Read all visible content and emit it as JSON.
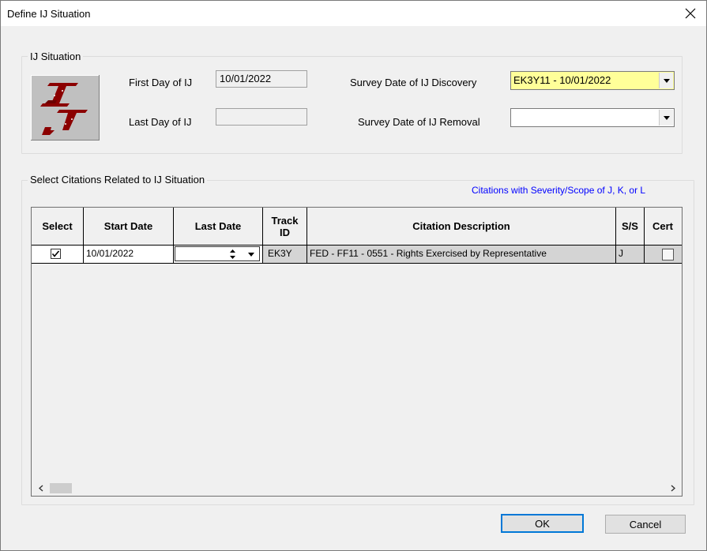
{
  "window": {
    "title": "Define IJ Situation"
  },
  "ij_group": {
    "label": "IJ Situation",
    "first_day_label": "First Day of IJ",
    "first_day_value": "10/01/2022",
    "last_day_label": "Last Day of IJ",
    "last_day_value": "",
    "discovery_label": "Survey Date of IJ Discovery",
    "discovery_value": "EK3Y11 - 10/01/2022",
    "removal_label": "Survey Date of IJ Removal",
    "removal_value": "",
    "colors": {
      "discovery_bg": "#ffff99",
      "logo_red": "#8b0000",
      "logo_bg": "#c0c0c0"
    }
  },
  "citations_group": {
    "label": "Select Citations Related to IJ Situation",
    "filter_link": "Citations with Severity/Scope of J, K, or L",
    "columns": [
      "Select",
      "Start Date",
      "Last Date",
      "Track ID",
      "Citation Description",
      "S/S",
      "Cert"
    ],
    "rows": [
      {
        "selected": true,
        "start_date": "10/01/2022",
        "last_date": "",
        "track_id": "EK3Y",
        "description": "FED - FF11 - 0551 - Rights Exercised by Representative",
        "ss": "J",
        "cert": false
      }
    ]
  },
  "buttons": {
    "ok": "OK",
    "cancel": "Cancel"
  },
  "icons": [
    "close-icon",
    "dropdown-arrow-icon",
    "spin-up-icon",
    "spin-down-icon",
    "scroll-left-icon",
    "scroll-right-icon",
    "ij-logo"
  ]
}
